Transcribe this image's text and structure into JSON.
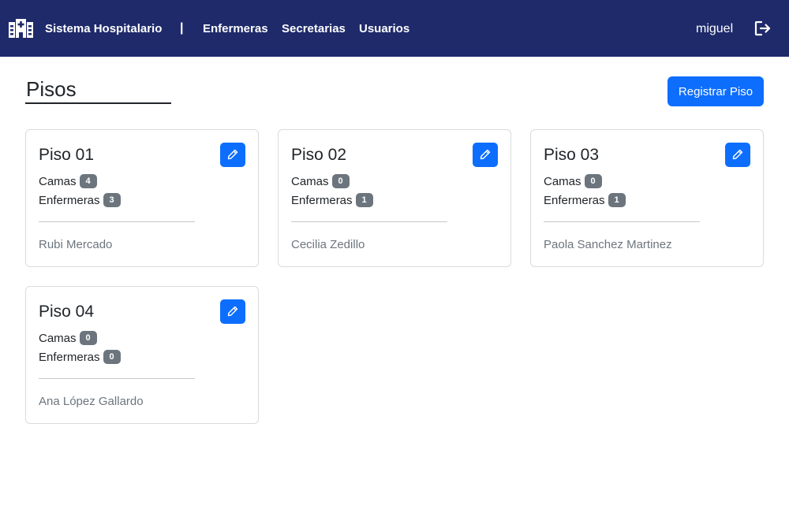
{
  "nav": {
    "brand": "Sistema Hospitalario",
    "separator": "|",
    "links": [
      "Enfermeras",
      "Secretarias",
      "Usuarios"
    ],
    "user": "miguel",
    "brand_icon": "hospital-icon",
    "logout_icon": "logout-icon"
  },
  "page": {
    "title": "Pisos",
    "register_button": "Registrar Piso"
  },
  "labels": {
    "camas": "Camas",
    "enfermeras": "Enfermeras"
  },
  "floors": [
    {
      "name": "Piso 01",
      "camas": "4",
      "enfermeras": "3",
      "nurse": "Rubi Mercado"
    },
    {
      "name": "Piso 02",
      "camas": "0",
      "enfermeras": "1",
      "nurse": "Cecilia Zedillo"
    },
    {
      "name": "Piso 03",
      "camas": "0",
      "enfermeras": "1",
      "nurse": "Paola Sanchez Martinez"
    },
    {
      "name": "Piso 04",
      "camas": "0",
      "enfermeras": "0",
      "nurse": "Ana López Gallardo"
    }
  ],
  "colors": {
    "navbar": "#1f2a6b",
    "primary": "#0d6efd",
    "badge": "#6c757d"
  }
}
